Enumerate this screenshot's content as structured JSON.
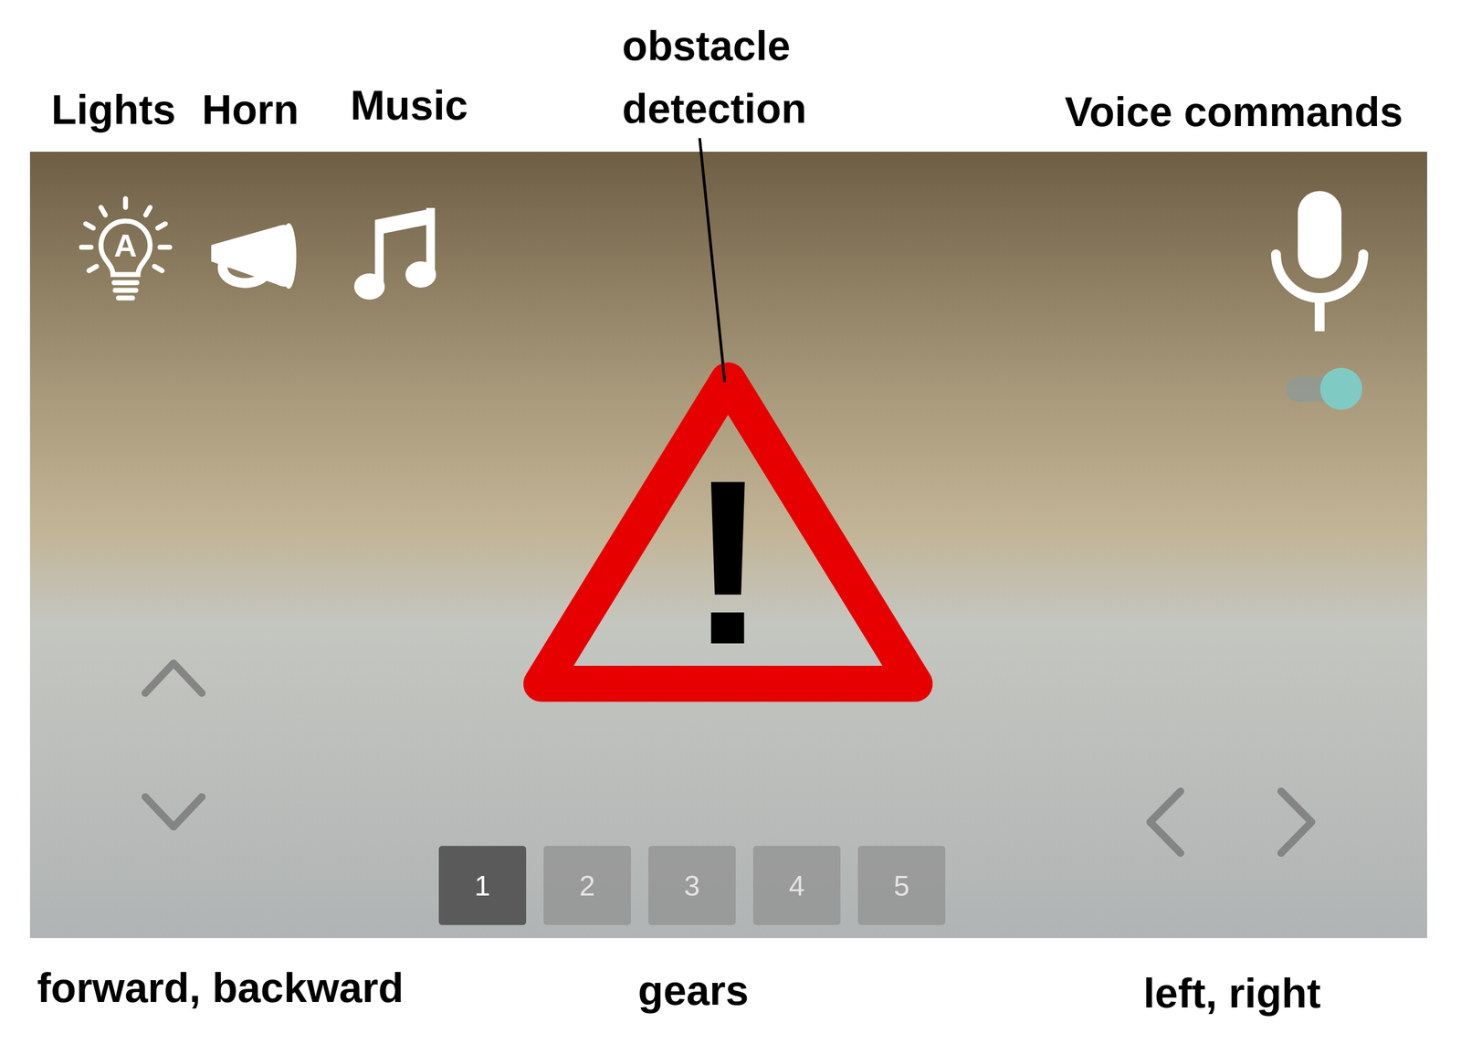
{
  "labels": {
    "lights": "Lights",
    "horn": "Horn",
    "music": "Music",
    "obstacle_detection": [
      "obstacle",
      "detection"
    ],
    "voice_commands": "Voice commands",
    "forward_backward": "forward, backward",
    "gears": "gears",
    "left_right": "left, right"
  },
  "camera_view": {
    "lights": {
      "mode": "A"
    },
    "voice_commands": {
      "on": true
    },
    "obstacle_warning": {
      "shown": true,
      "symbol": "!"
    },
    "gears": [
      {
        "label": "1",
        "selected": true
      },
      {
        "label": "2",
        "selected": false
      },
      {
        "label": "3",
        "selected": false
      },
      {
        "label": "4",
        "selected": false
      },
      {
        "label": "5",
        "selected": false
      }
    ]
  }
}
